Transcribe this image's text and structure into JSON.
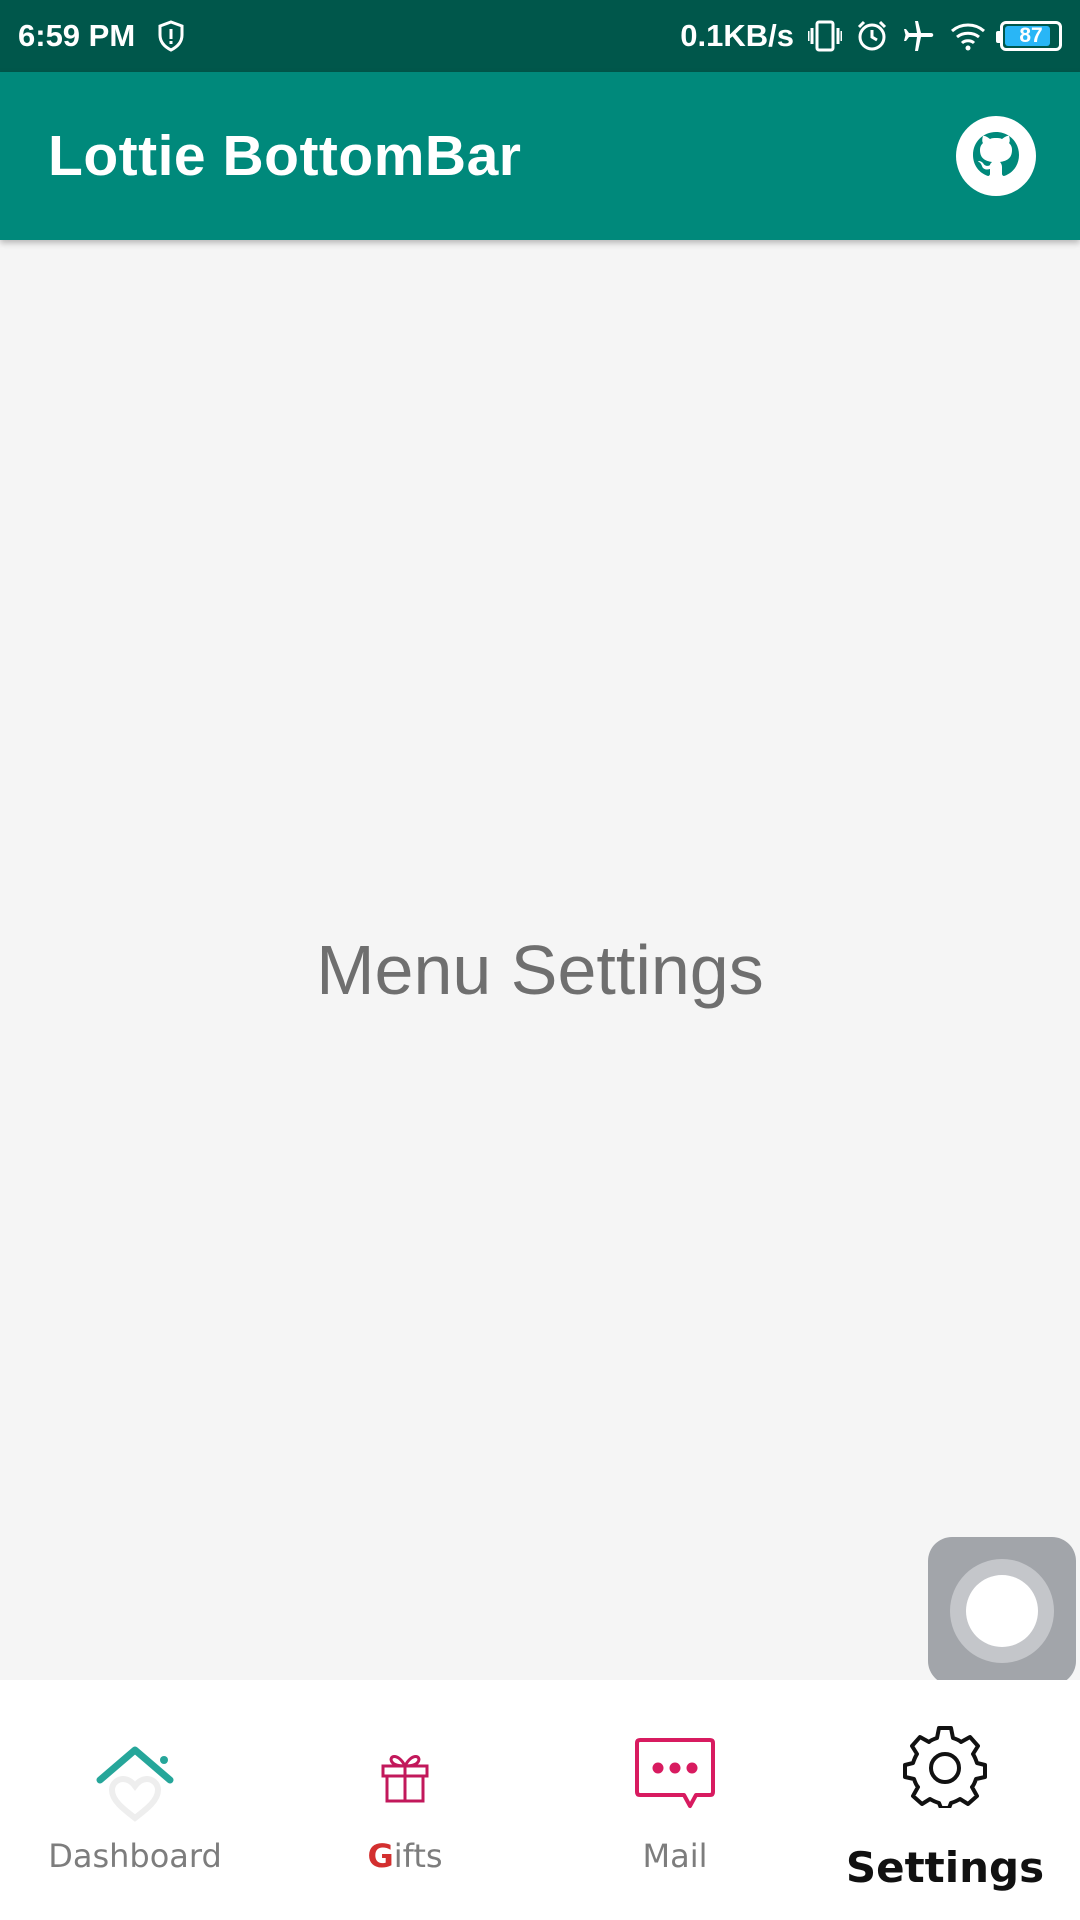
{
  "status_bar": {
    "time": "6:59 PM",
    "net_speed": "0.1KB/s",
    "battery_level": "87",
    "icons": [
      "shield-alert-icon",
      "vibrate-icon",
      "alarm-icon",
      "airplane-icon",
      "wifi-icon",
      "battery-icon"
    ],
    "battery_fill_fraction": 0.87,
    "battery_color": "#29b6f6"
  },
  "app_bar": {
    "title": "Lottie BottomBar",
    "action_icon": "github-icon",
    "color": "#00897b"
  },
  "main": {
    "message": "Menu Settings"
  },
  "floating": {
    "icon": "assistive-touch-icon"
  },
  "bottom_nav": {
    "items": [
      {
        "label": "Dashboard",
        "icon": "house-heart-icon",
        "active": false
      },
      {
        "label_first": "G",
        "label_rest": "ifts",
        "icon": "gift-icon",
        "active": false
      },
      {
        "label": "Mail",
        "icon": "chat-bubble-icon",
        "active": false
      },
      {
        "label": "Settings",
        "icon": "gear-icon",
        "active": true
      }
    ],
    "colors": {
      "dashboard": "#26a69a",
      "gifts": "#c2185b",
      "mail": "#d81b60",
      "settings": "#111111"
    }
  }
}
